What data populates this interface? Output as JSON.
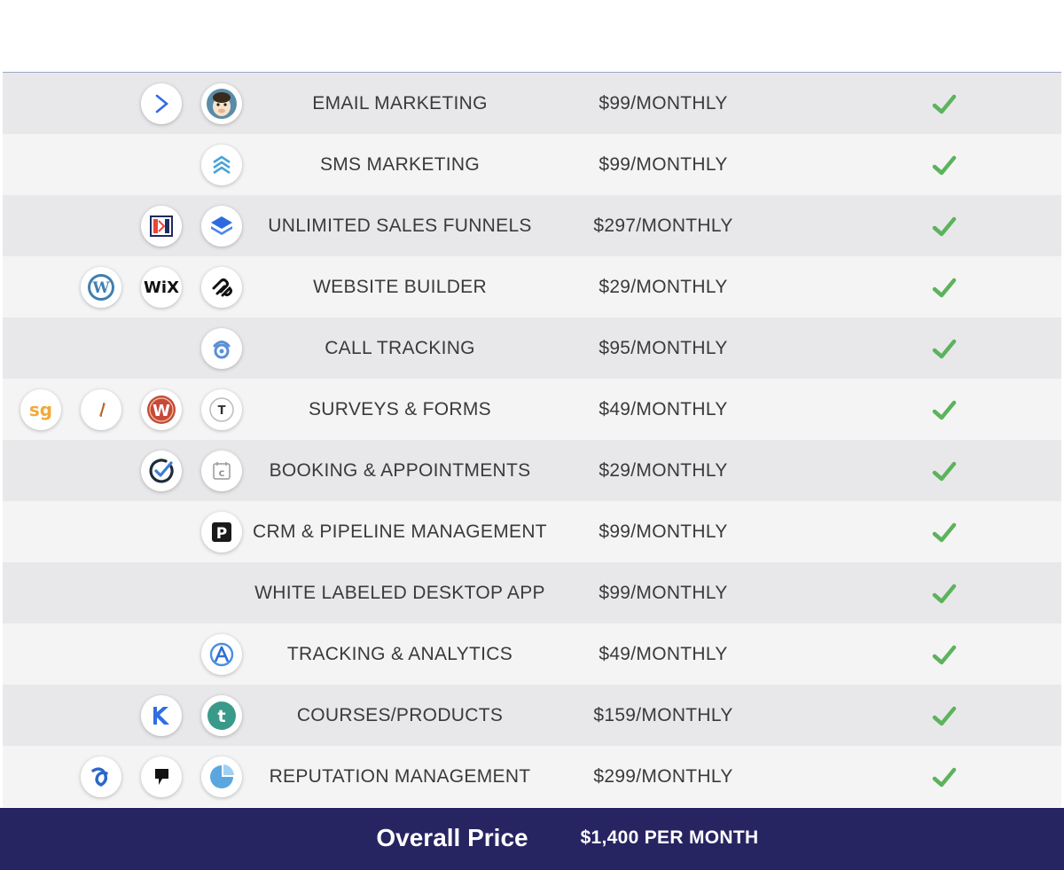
{
  "rows": [
    {
      "feature": "EMAIL MARKETING",
      "price": "$99/MONTHLY",
      "icons": [
        "activecampaign-icon",
        "mailchimp-icon"
      ]
    },
    {
      "feature": "SMS MARKETING",
      "price": "$99/MONTHLY",
      "icons": [
        "sms-platform-icon"
      ]
    },
    {
      "feature": "UNLIMITED SALES FUNNELS",
      "price": "$297/MONTHLY",
      "icons": [
        "clickfunnels-icon",
        "layers-icon"
      ]
    },
    {
      "feature": "WEBSITE BUILDER",
      "price": "$29/MONTHLY",
      "icons": [
        "wordpress-icon",
        "wix-icon",
        "squarespace-icon"
      ]
    },
    {
      "feature": "CALL TRACKING",
      "price": "$95/MONTHLY",
      "icons": [
        "call-tracking-icon"
      ]
    },
    {
      "feature": "SURVEYS & FORMS",
      "price": "$49/MONTHLY",
      "icons": [
        "surveygizmo-icon",
        "formstack-icon",
        "wufoo-icon",
        "typeform-icon"
      ]
    },
    {
      "feature": "BOOKING & APPOINTMENTS",
      "price": "$29/MONTHLY",
      "icons": [
        "acuity-icon",
        "calendly-icon"
      ]
    },
    {
      "feature": "CRM & PIPELINE MANAGEMENT",
      "price": "$99/MONTHLY",
      "icons": [
        "pipedrive-icon"
      ]
    },
    {
      "feature": "WHITE LABELED DESKTOP APP",
      "price": "$99/MONTHLY",
      "icons": []
    },
    {
      "feature": "TRACKING & ANALYTICS",
      "price": "$49/MONTHLY",
      "icons": [
        "analytics-icon"
      ]
    },
    {
      "feature": "COURSES/PRODUCTS",
      "price": "$159/MONTHLY",
      "icons": [
        "kajabi-icon",
        "teachable-icon"
      ]
    },
    {
      "feature": "REPUTATION MANAGEMENT",
      "price": "$299/MONTHLY",
      "icons": [
        "birdeye-icon",
        "podium-icon",
        "reputation-icon"
      ]
    }
  ],
  "icon_glyphs": {
    "sg": "sg",
    "wix": "WiX",
    "W": "W",
    "T": "T",
    "t": "t",
    "P": "P",
    "C": "C"
  },
  "footer": {
    "label": "Overall Price",
    "total": "$1,400 PER MONTH"
  },
  "colors": {
    "footer_bg": "#272462",
    "check": "#5cb35c",
    "row_dark": "#e8e8ea",
    "row_light": "#f4f4f5"
  }
}
